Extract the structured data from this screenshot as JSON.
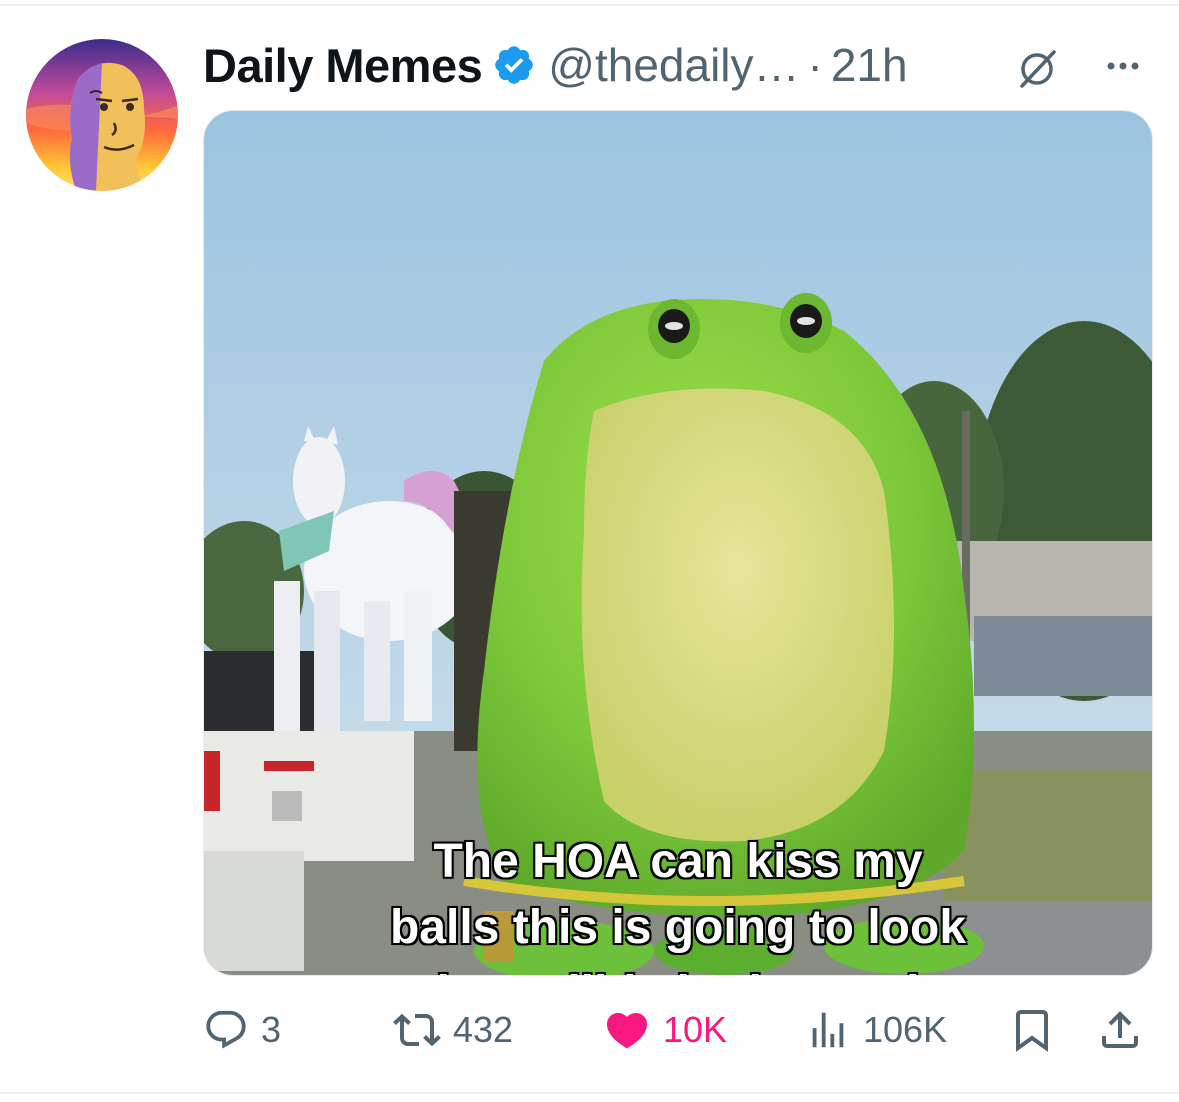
{
  "post": {
    "author_name": "Daily Memes",
    "handle": "@thedaily…",
    "separator": "·",
    "time": "21h",
    "image_caption_lines": [
      "The HOA can kiss my",
      "balls this is going to look",
      "incredible in the yard"
    ]
  },
  "actions": {
    "replies": "3",
    "reposts": "432",
    "likes": "10K",
    "views": "106K"
  },
  "colors": {
    "verified": "#1d9bf0",
    "like": "#f91880",
    "secondary_text": "#536471",
    "primary_text": "#0f1419"
  },
  "icons": {
    "reply": "speech-bubble-icon",
    "repost": "repost-arrows-icon",
    "like": "heart-icon",
    "views": "bar-chart-icon",
    "bookmark": "bookmark-icon",
    "share": "upload-share-icon",
    "grok": "grok-icon",
    "more": "ellipsis-icon"
  }
}
